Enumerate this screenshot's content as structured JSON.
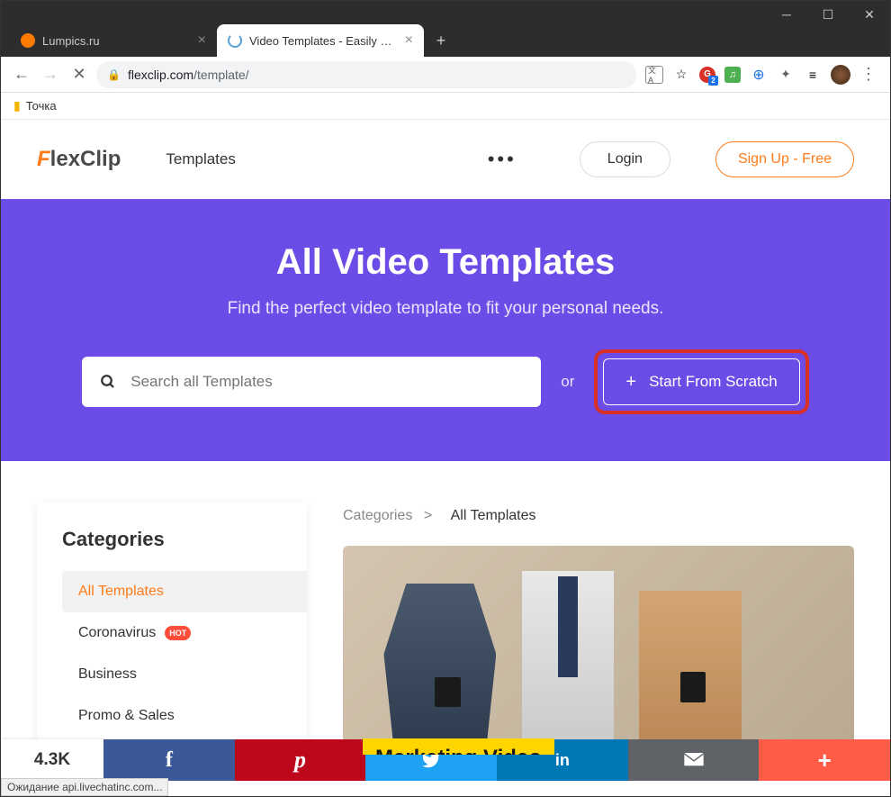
{
  "browser": {
    "tabs": [
      {
        "title": "Lumpics.ru",
        "active": false
      },
      {
        "title": "Video Templates - Easily Make Yo",
        "active": true
      }
    ],
    "url_host": "flexclip.com",
    "url_path": "/template/",
    "bookmark": "Точка",
    "status": "Ожидание api.livechatinc.com..."
  },
  "header": {
    "logo_part1": "F",
    "logo_part2": "lexClip",
    "nav_templates": "Templates",
    "login": "Login",
    "signup": "Sign Up - Free"
  },
  "hero": {
    "title": "All Video Templates",
    "subtitle": "Find the perfect video template to fit your personal needs.",
    "search_placeholder": "Search all Templates",
    "or": "or",
    "scratch": "Start From Scratch"
  },
  "sidebar": {
    "title": "Categories",
    "items": [
      {
        "label": "All Templates",
        "active": true,
        "hot": false
      },
      {
        "label": "Coronavirus",
        "active": false,
        "hot": true
      },
      {
        "label": "Business",
        "active": false,
        "hot": false
      },
      {
        "label": "Promo & Sales",
        "active": false,
        "hot": false
      }
    ],
    "hot_badge": "HOT"
  },
  "breadcrumb": {
    "root": "Categories",
    "sep": ">",
    "current": "All Templates"
  },
  "template_card": {
    "label": "Marketing Video"
  },
  "share": {
    "count": "4.3K"
  }
}
